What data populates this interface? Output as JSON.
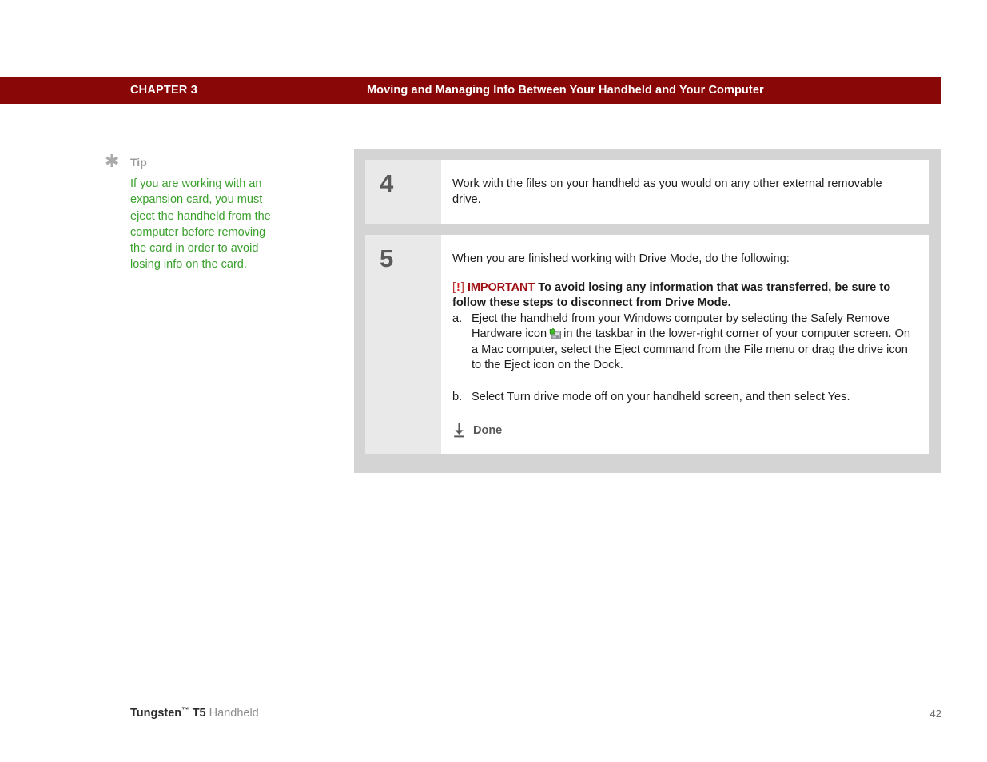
{
  "header": {
    "chapter_label": "CHAPTER 3",
    "title": "Moving and Managing Info Between Your Handheld and Your Computer",
    "band_color": "#8a0707"
  },
  "tip": {
    "icon": "asterisk-icon",
    "label": "Tip",
    "text": "If you are working with an expansion card, you must eject the handheld from the computer before removing the card in order to avoid losing info on the card.",
    "text_color": "#3aa02c",
    "label_color": "#9b9b9b"
  },
  "steps": [
    {
      "number": "4",
      "text": "Work with the files on your handheld as you would on any other external removable drive."
    },
    {
      "number": "5",
      "intro": "When you are finished working with Drive Mode, do the following:",
      "important": {
        "bracket_open": "[",
        "bang": "!",
        "bracket_close": "]",
        "label": "IMPORTANT",
        "text": "To avoid losing any information that was transferred, be sure to follow these steps to disconnect from Drive Mode.",
        "label_color": "#9e0e12",
        "bang_color": "#d81f1f"
      },
      "substeps": [
        {
          "marker": "a.",
          "text_before_icon": "Eject the handheld from your Windows computer by selecting the Safely Remove Hardware icon",
          "icon": "safely-remove-hardware-icon",
          "text_after_icon": "in the taskbar in the lower-right corner of your computer screen. On a Mac computer, select the Eject command from the File menu or drag the drive icon to the Eject icon on the Dock."
        },
        {
          "marker": "b.",
          "text_before_icon": "Select Turn drive mode off on your handheld screen, and then select Yes.",
          "icon": "",
          "text_after_icon": ""
        }
      ],
      "done": {
        "icon": "download-arrow-icon",
        "label": "Done"
      }
    }
  ],
  "footer": {
    "brand": "Tungsten",
    "trademark": "™",
    "model_suffix": " T5",
    "product": " Handheld",
    "page_number": "42"
  }
}
